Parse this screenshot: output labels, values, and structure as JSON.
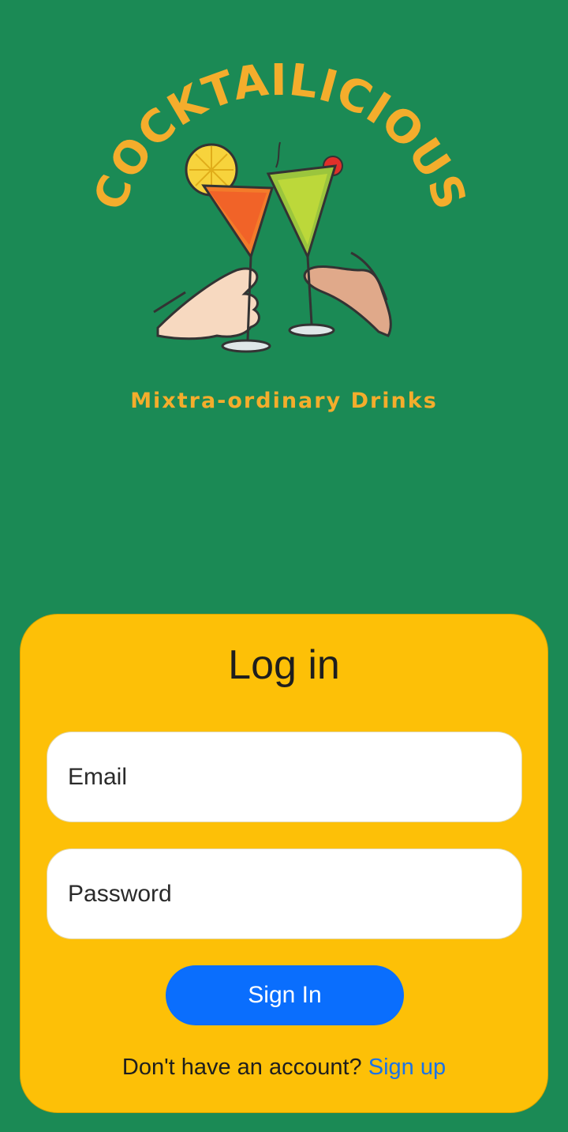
{
  "logo": {
    "brand": "COCKTAILICIOUS",
    "tagline": "Mixtra-ordinary Drinks",
    "image": "cocktail-cheers-illustration"
  },
  "login": {
    "title": "Log in",
    "email_placeholder": "Email",
    "password_placeholder": "Password",
    "signin_label": "Sign In",
    "no_account_text": "Don't have an account?",
    "signup_label": "Sign up"
  },
  "colors": {
    "background": "#1b8a55",
    "card": "#fdc007",
    "primary_button": "#0a6efd",
    "link": "#1a73e8",
    "logo_text": "#f4ad2c"
  }
}
